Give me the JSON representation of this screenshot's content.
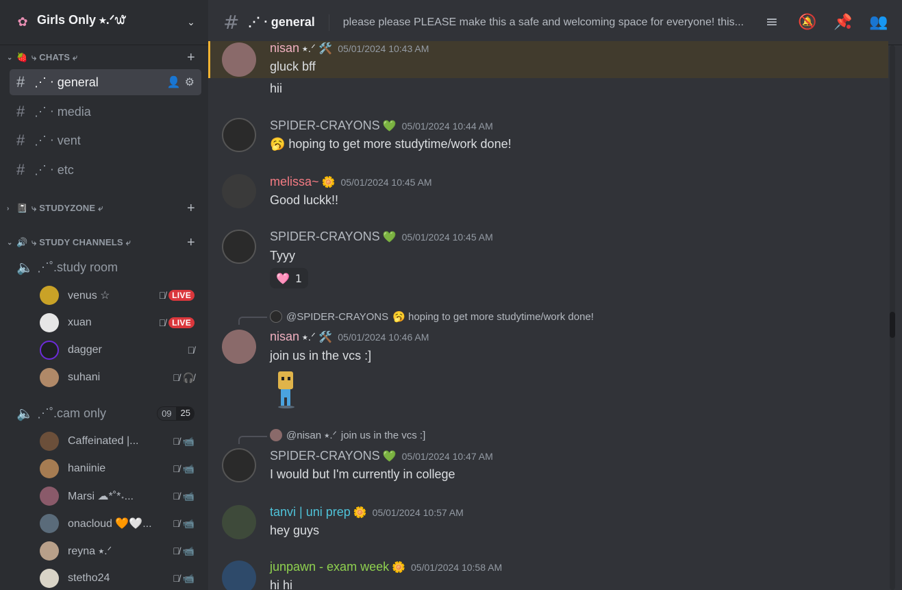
{
  "server": {
    "name": "Girls Only ⭑.ᐟ᭙",
    "icon": "flower-icon"
  },
  "categories": [
    {
      "emoji": "🍓",
      "label": "⤷ CHATS ⤶"
    },
    {
      "emoji": "📓",
      "label": "⤷ STUDYZONE ⤶"
    },
    {
      "emoji": "🔊",
      "label": "⤷ STUDY CHANNELS ⤶"
    }
  ],
  "text_channels": [
    {
      "name": "⋰ ⋅ general",
      "active": true
    },
    {
      "name": "⋰ ⋅ media"
    },
    {
      "name": "⋰ ⋅ vent"
    },
    {
      "name": "⋰ ⋅ etc"
    }
  ],
  "voice_channels": [
    {
      "name": "⋰˚.study room"
    },
    {
      "name": "⋰˚.cam only",
      "capacity_current": "09",
      "capacity_max": "25"
    }
  ],
  "study_room_members": [
    {
      "name": "venus ☆",
      "live": "LIVE",
      "color": "#c9a227"
    },
    {
      "name": "xuan",
      "live": "LIVE",
      "color": "#e6e6e6"
    },
    {
      "name": "dagger",
      "color": "#6c2bd9"
    },
    {
      "name": "suhani",
      "color": "#b08968"
    }
  ],
  "cam_only_members": [
    {
      "name": "Caffeinated |...",
      "color": "#6b4f3a"
    },
    {
      "name": "haniinie",
      "color": "#a67c52"
    },
    {
      "name": "Marsi ☁*˚*˖...",
      "color": "#8a5a6a"
    },
    {
      "name": "onacloud 🧡🤍...",
      "color": "#5a6b7a"
    },
    {
      "name": "reyna ⭑.ᐟ",
      "color": "#b8a08a"
    },
    {
      "name": "stetho24",
      "color": "#d9d4c7"
    }
  ],
  "topbar": {
    "channel": "⋰ ⋅ general",
    "topic": "please please PLEASE make this a safe and welcoming space for everyone! this..."
  },
  "messages": [
    {
      "user": "nisan",
      "badge": "⭑.ᐟ 🛠️",
      "ts": "05/01/2024 10:43 AM",
      "text": "gluck bff",
      "color": "#f0b0c0"
    },
    {
      "text": "hii"
    },
    {
      "user": "SPIDER-CRAYONS",
      "badge": "💚",
      "ts": "05/01/2024 10:44 AM",
      "text": "🥱 hoping to get more studytime/work done!",
      "color": "#b5bac1"
    },
    {
      "user": "melissa~",
      "badge": "🌼",
      "ts": "05/01/2024 10:45 AM",
      "text": "Good luckk!!",
      "color": "#f47b83"
    },
    {
      "user": "SPIDER-CRAYONS",
      "badge": "💚",
      "ts": "05/01/2024 10:45 AM",
      "text": "Tyyy",
      "color": "#b5bac1",
      "reaction_emoji": "🩷",
      "reaction_count": "1"
    },
    {
      "reply_to": "@SPIDER-CRAYONS",
      "reply_text": "🥱 hoping to get more studytime/work done!",
      "user": "nisan",
      "badge": "⭑.ᐟ 🛠️",
      "ts": "05/01/2024 10:46 AM",
      "text": "join us in the vcs :]",
      "color": "#f0b0c0"
    },
    {
      "reply_to": "@nisan ⭑.ᐟ",
      "reply_text": "join us in the vcs :]",
      "user": "SPIDER-CRAYONS",
      "badge": "💚",
      "ts": "05/01/2024 10:47 AM",
      "text": "I would but I'm currently in college",
      "color": "#b5bac1"
    },
    {
      "user": "tanvi | uni prep",
      "badge": "🌼",
      "ts": "05/01/2024 10:57 AM",
      "text": "hey guys",
      "color": "#4fc3d9"
    },
    {
      "user": "junpawn - exam week",
      "badge": "🌼",
      "ts": "05/01/2024 10:58 AM",
      "text": "hi hi",
      "color": "#8fd14f"
    }
  ],
  "colors": {
    "accent": "#5865f2",
    "live": "#da373c",
    "highlight": "#f0b232"
  }
}
